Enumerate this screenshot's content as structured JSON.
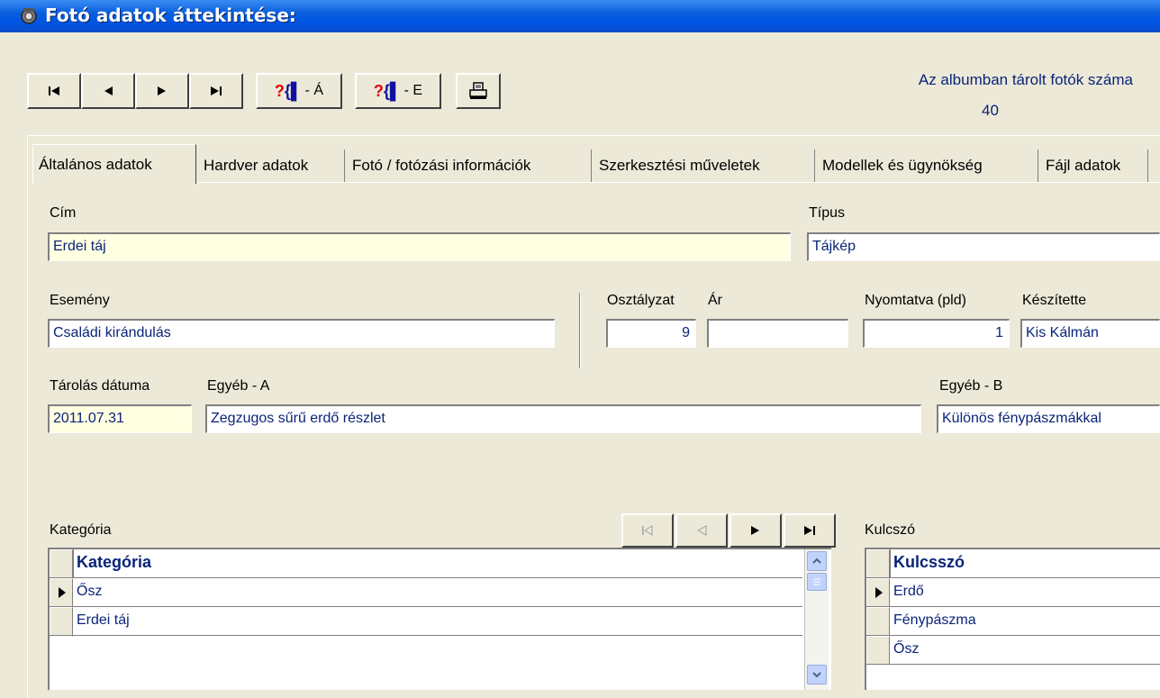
{
  "window": {
    "title": "Fotó adatok áttekintése:",
    "icon": "app-icon"
  },
  "toolbar": {
    "buttons": [
      {
        "name": "first-record",
        "icon": "first-icon"
      },
      {
        "name": "prev-record",
        "icon": "prev-icon"
      },
      {
        "name": "next-record",
        "icon": "next-icon"
      },
      {
        "name": "last-record",
        "icon": "last-icon"
      }
    ],
    "query_a_label": "- Á",
    "query_e_label": "- E",
    "query_glyph": "?{",
    "print_icon": "print-icon"
  },
  "album": {
    "count_label": "Az albumban tárolt fotók száma",
    "count_value": "40"
  },
  "tabs": [
    {
      "label": "Általános adatok",
      "active": true
    },
    {
      "label": "Hardver adatok"
    },
    {
      "label": "Fotó / fotózási információk"
    },
    {
      "label": "Szerkesztési műveletek"
    },
    {
      "label": "Modellek és ügynökség"
    },
    {
      "label": "Fájl adatok"
    }
  ],
  "form": {
    "cim_label": "Cím",
    "cim_value": "Erdei táj",
    "tipus_label": "Típus",
    "tipus_value": "Tájkép",
    "esemeny_label": "Esemény",
    "esemeny_value": "Családi kirándulás",
    "osztalyzat_label": "Osztályzat",
    "osztalyzat_value": "9",
    "ar_label": "Ár",
    "ar_value": "",
    "nyomtatva_label": "Nyomtatva (pld)",
    "nyomtatva_value": "1",
    "keszitette_label": "Készítette",
    "keszitette_value": "Kis Kálmán",
    "tarolas_label": "Tárolás dátuma",
    "tarolas_value": "2011.07.31",
    "egyeb_a_label": "Egyéb - A",
    "egyeb_a_value": "Zegzugos sűrű erdő részlet",
    "egyeb_b_label": "Egyéb - B",
    "egyeb_b_value": "Különös fénypászmákkal"
  },
  "category": {
    "label": "Kategória",
    "header": "Kategória",
    "rows": [
      "Ősz",
      "Erdei táj"
    ]
  },
  "keyword": {
    "label": "Kulcszó",
    "header": "Kulcsszó",
    "rows": [
      "Erdő",
      "Fénypászma",
      "Ősz"
    ]
  },
  "colors": {
    "title_bar": "#0054E3",
    "face": "#ECE9D8",
    "value_text": "#0A2478",
    "highlight_field": "#FFFFE1"
  }
}
